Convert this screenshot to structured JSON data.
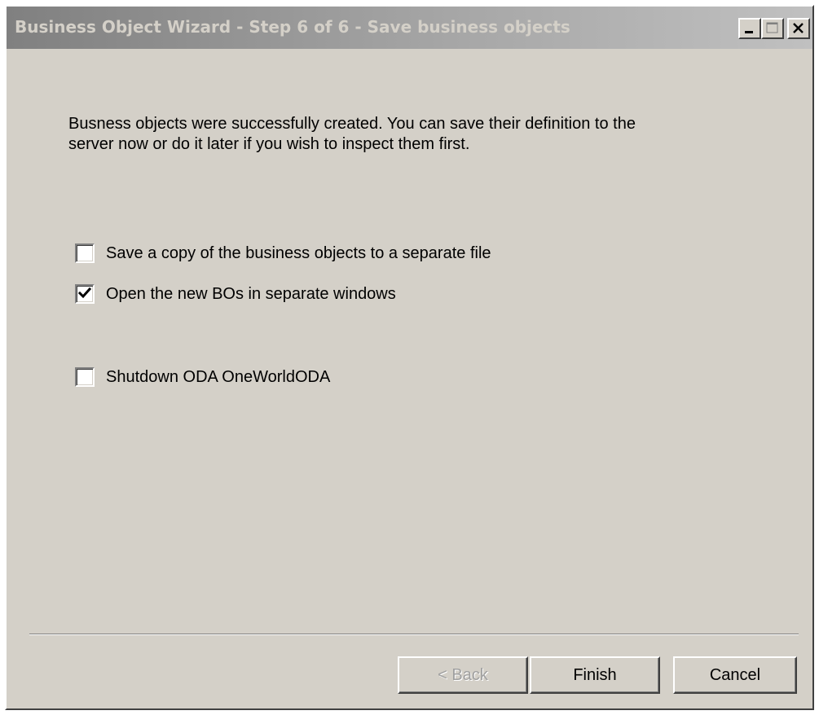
{
  "window": {
    "title": "Business Object Wizard - Step 6 of 6 - Save business objects",
    "controls": {
      "minimize_icon": "minimize-icon",
      "maximize_icon": "maximize-icon",
      "close_icon": "close-icon"
    }
  },
  "main": {
    "message_line1": "Busness objects were successfully created. You can save their definition to the",
    "message_line2": "server now or do it later if you wish to inspect them first.",
    "options": [
      {
        "label": "Save a copy of the business objects to a separate file",
        "checked": false
      },
      {
        "label": "Open the new BOs in separate windows",
        "checked": true
      },
      {
        "label": "Shutdown ODA OneWorldODA",
        "checked": false
      }
    ]
  },
  "footer": {
    "back_label": "< Back",
    "back_enabled": false,
    "finish_label": "Finish",
    "cancel_label": "Cancel"
  },
  "colors": {
    "face": "#d4d0c8",
    "title_gradient_start": "#808080",
    "title_gradient_end": "#c0c0c0",
    "disabled_text": "#a0a0a0"
  }
}
